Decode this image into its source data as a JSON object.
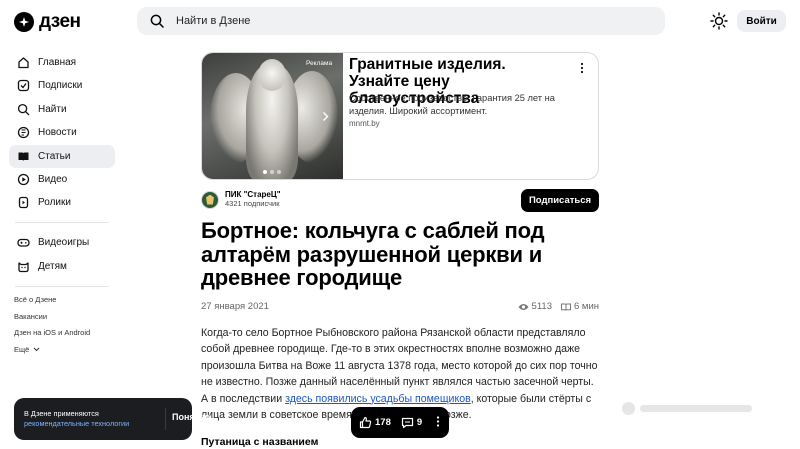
{
  "header": {
    "logo_text": "дзен",
    "search_placeholder": "Найти в Дзене",
    "login_label": "Войти"
  },
  "sidebar": {
    "items": [
      {
        "label": "Главная",
        "icon": "home-icon"
      },
      {
        "label": "Подписки",
        "icon": "subscriptions-icon"
      },
      {
        "label": "Найти",
        "icon": "search-icon"
      },
      {
        "label": "Новости",
        "icon": "news-icon"
      },
      {
        "label": "Статьи",
        "icon": "articles-icon",
        "active": true
      },
      {
        "label": "Видео",
        "icon": "video-icon"
      },
      {
        "label": "Ролики",
        "icon": "shorts-icon"
      }
    ],
    "extra_items": [
      {
        "label": "Видеоигры",
        "icon": "gamepad-icon"
      },
      {
        "label": "Детям",
        "icon": "kids-icon"
      }
    ],
    "footer_links": [
      "Всё о Дзене",
      "Вакансии",
      "Дзен на iOS и Android",
      "Ещё"
    ]
  },
  "ad": {
    "badge": "Реклама",
    "title": "Гранитные изделия. Узнайте цену благоустройства",
    "description": "Собственное производство. Гарантия 25 лет на изделия. Широкий ассортимент.",
    "domain": "mnmt.by"
  },
  "channel": {
    "name": "ПИК \"СтареЦ\"",
    "subscribers": "4321 подписчик",
    "subscribe_label": "Подписаться"
  },
  "article": {
    "title": "Бортное: кольчуга с саблей под алтарём разрушенной церкви и древнее городище",
    "date": "27 января 2021",
    "views": "5113",
    "read_time": "6 мин",
    "para_before_link": "Когда-то село Бортное Рыбновского района Рязанской области представляло собой древнее городище. Где-то в этих окрестностях вполне возможно даже произошла Битва на Воже 11 августа 1378 года, место которой до сих пор точно не известно. Позже данный населённый пункт являлся частью засечной черты. А в последствии ",
    "link_text": "здесь появились усадьбы помещиков",
    "para_after_link": ", которые были стёрты с лица земли в советское время. Но об этом чуть позже.",
    "subheading": "Путаница с названием"
  },
  "cookie": {
    "text": "В Дзене применяются",
    "link": "рекомендательные технологии",
    "button": "Понятно"
  },
  "actions": {
    "likes": "178",
    "comments": "9"
  }
}
